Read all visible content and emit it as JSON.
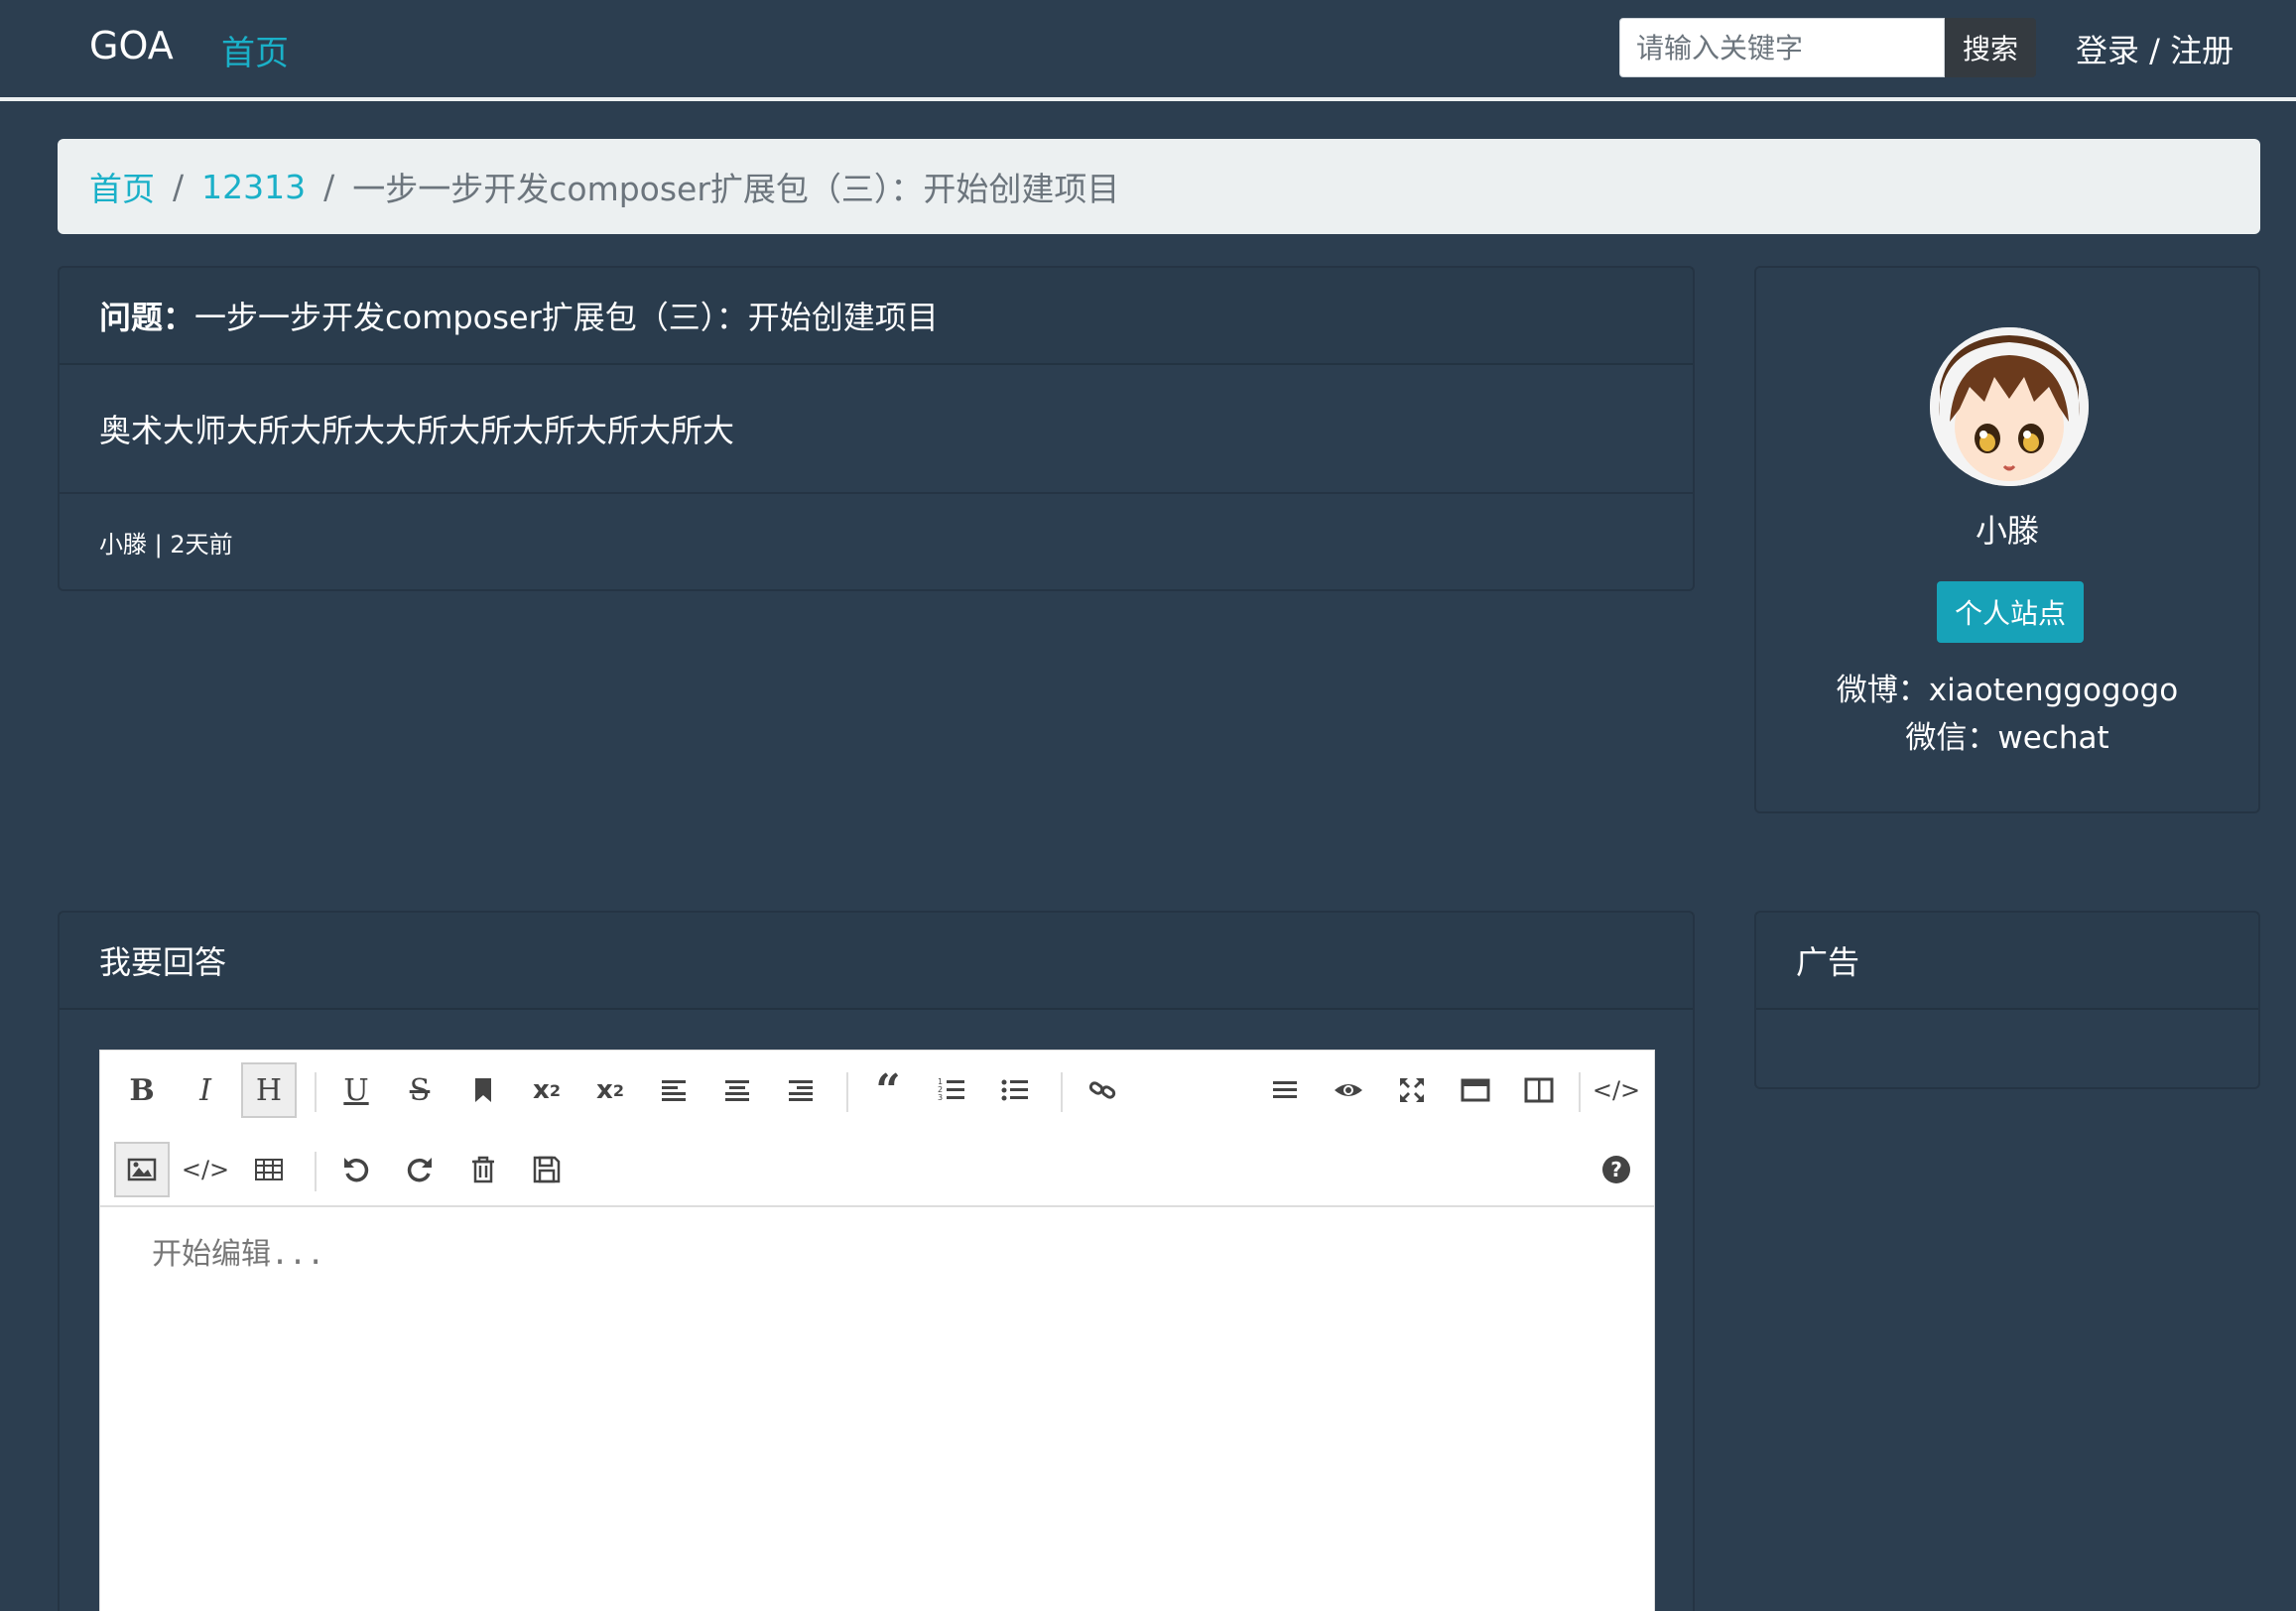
{
  "navbar": {
    "brand": "GOA",
    "home": "首页",
    "search_placeholder": "请输入关键字",
    "search_button": "搜索",
    "login": "登录 / 注册"
  },
  "breadcrumb": {
    "home": "首页",
    "category": "12313",
    "current": "一步一步开发composer扩展包（三）：开始创建项目"
  },
  "question": {
    "title_label": "问题：",
    "title": "一步一步开发composer扩展包（三）：开始创建项目",
    "body": "奥术大师大所大所大大所大所大所大所大所大",
    "meta": "小滕 | 2天前"
  },
  "profile": {
    "name": "小滕",
    "site_button": "个人站点",
    "weibo": "微博：xiaotenggogogo",
    "wechat": "微信：wechat"
  },
  "answer": {
    "header": "我要回答",
    "placeholder": "开始编辑..."
  },
  "ad": {
    "header": "广告"
  },
  "toolbar": {
    "row1": [
      "bold",
      "italic",
      "heading",
      "underline",
      "strikethrough",
      "bookmark",
      "superscript",
      "subscript",
      "align-left",
      "align-center",
      "align-right",
      "quote",
      "ordered-list",
      "unordered-list",
      "link"
    ],
    "row1_right": [
      "menu",
      "preview",
      "fullscreen",
      "window",
      "split",
      "html"
    ],
    "row2": [
      "image",
      "code",
      "table",
      "undo",
      "redo",
      "trash",
      "save"
    ],
    "row2_right": [
      "help"
    ]
  },
  "colors": {
    "background": "#2c3e50",
    "accent": "#1ab0c8",
    "button": "#17a2b8"
  }
}
